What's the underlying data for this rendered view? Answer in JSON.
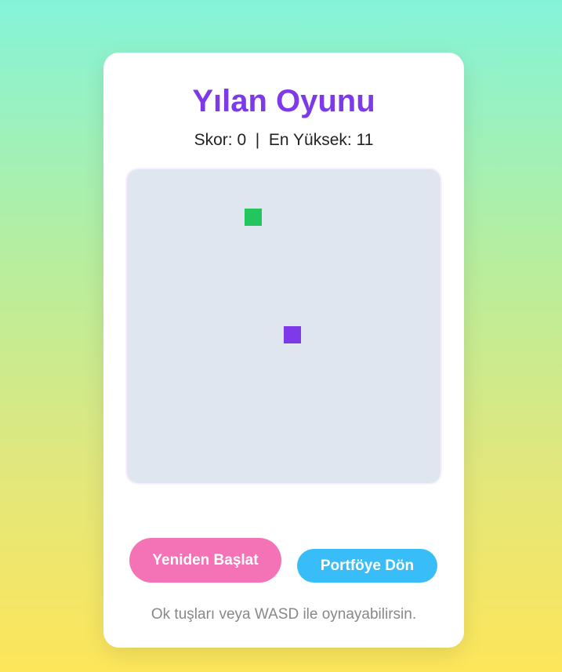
{
  "game": {
    "title": "Yılan Oyunu",
    "score_line": "Skor: 0  |  En Yüksek: 11",
    "score": 0,
    "high_score": 11,
    "food_color": "#22c55e",
    "snake_color": "#7e3ae8",
    "board_color": "#e0e6ef"
  },
  "controls": {
    "restart_label": "Yeniden Başlat",
    "portfolio_label": "Portföye Dön"
  },
  "hint": "Ok tuşları veya WASD ile oynayabilirsin."
}
